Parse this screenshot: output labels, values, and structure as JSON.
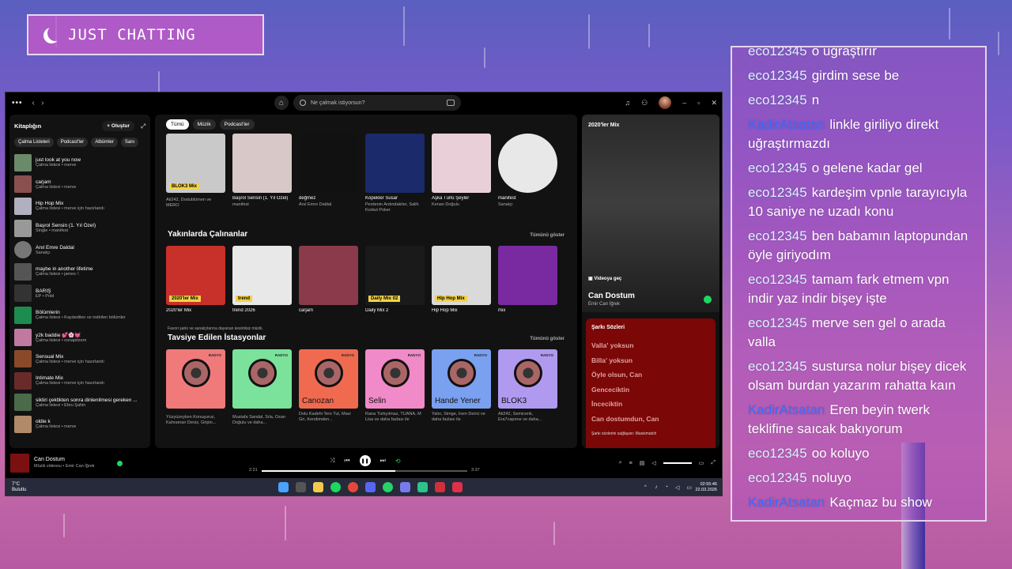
{
  "overlay": {
    "title": "JUST CHATTING"
  },
  "chat": {
    "messages": [
      {
        "user": "eco12345",
        "text": "o uğraştırır",
        "color": "#d9f3ff"
      },
      {
        "user": "eco12345",
        "text": "girdim sese be",
        "color": "#d9f3ff"
      },
      {
        "user": "eco12345",
        "text": "n",
        "color": "#d9f3ff"
      },
      {
        "user": "KadirAtsatan",
        "text": "linkle giriliyo direkt uğraştırmazdı",
        "color": "#3b6dff"
      },
      {
        "user": "eco12345",
        "text": "o gelene kadar gel",
        "color": "#d9f3ff"
      },
      {
        "user": "eco12345",
        "text": "kardeşim vpnle tarayıcıyla 10 saniye ne uzadı konu",
        "color": "#d9f3ff"
      },
      {
        "user": "eco12345",
        "text": "ben babamın laptopundan öyle giriyodım",
        "color": "#d9f3ff"
      },
      {
        "user": "eco12345",
        "text": "tamam fark etmem vpn indir yaz indir bişey işte",
        "color": "#d9f3ff"
      },
      {
        "user": "eco12345",
        "text": "merve sen gel o arada valla",
        "color": "#d9f3ff"
      },
      {
        "user": "eco12345",
        "text": "sustursa nolur bişey dicek olsam burdan yazarım rahatta kaın",
        "color": "#d9f3ff"
      },
      {
        "user": "KadirAtsatan",
        "text": "Eren beyin twerk teklifine saıcak bakıyorum",
        "color": "#3b6dff"
      },
      {
        "user": "eco12345",
        "text": "oo koluyo",
        "color": "#d9f3ff"
      },
      {
        "user": "eco12345",
        "text": "noluyo",
        "color": "#d9f3ff"
      },
      {
        "user": "KadirAtsatan",
        "text": "Kaçmaz bu show",
        "color": "#3b6dff"
      }
    ]
  },
  "spotify": {
    "search_placeholder": "Ne çalmak istiyorsun?",
    "library": {
      "title": "Kitaplığın",
      "create": "+ Oluştur",
      "chips": [
        "Çalma Listeleri",
        "Podcast'ler",
        "Albümler",
        "Sanı"
      ],
      "items": [
        {
          "name": "just look at you now",
          "sub": "Çalma listesi • merve",
          "color": "#6a8a6a",
          "round": false
        },
        {
          "name": "carjam",
          "sub": "Çalma listesi • merve",
          "color": "#8a5050",
          "round": false
        },
        {
          "name": "Hip Hop Mix",
          "sub": "Çalma listesi • merve için hazırlandı",
          "color": "#b0b0c0",
          "round": false
        },
        {
          "name": "Başrol Sensin (1. Yıl Özel)",
          "sub": "Single • manifest",
          "color": "#999",
          "round": false
        },
        {
          "name": "Anıl Emre Daldal",
          "sub": "Sanatçı",
          "color": "#777",
          "round": true
        },
        {
          "name": "maybe in another lifetime",
          "sub": "Çalma listesi • james ☾",
          "color": "#555",
          "round": false
        },
        {
          "name": "BARIŞ",
          "sub": "EP • Pobl",
          "color": "#333",
          "round": false
        },
        {
          "name": "Bölümlerin",
          "sub": "Çalma listesi • Kaydedilen ve indirilen bölümler",
          "color": "#1e8c4e",
          "round": false
        },
        {
          "name": "y2k baddie 💕🌸💓",
          "sub": "Çalma listesi • osnapitzem",
          "color": "#c07aa0",
          "round": false
        },
        {
          "name": "Sensual Mix",
          "sub": "Çalma listesi • merve için hazırlandı",
          "color": "#8a4a2a",
          "round": false
        },
        {
          "name": "Intimate Mix",
          "sub": "Çalma listesi • merve için hazırlandı",
          "color": "#6a2a2a",
          "round": false
        },
        {
          "name": "siktiri çektikten sonra dinlenilmesi gereken ...",
          "sub": "Çalma listesi • Ebru Şahin",
          "color": "#4a6a4a",
          "round": false
        },
        {
          "name": "oldie k",
          "sub": "Çalma listesi • merve",
          "color": "#b08a6a",
          "round": false
        }
      ]
    },
    "tabs": [
      "Tümü",
      "Müzik",
      "Podcast'ler"
    ],
    "top_row": [
      {
        "title": "BLOK3 Mix",
        "sub": "Ati242, Dodublümen ve MERO",
        "color": "#c9c9c9",
        "round": false
      },
      {
        "title": "Başrol Sensin (1. Yıl Özel)",
        "sub": "manifest",
        "color": "#d8c8c8",
        "round": false
      },
      {
        "title": "değmez",
        "sub": "Anıl Emre Daldal",
        "color": "#111",
        "round": false
      },
      {
        "title": "Köpekler Susar",
        "sub": "Perdenin Ardındakiler, Salih Korkut Poker",
        "color": "#1a2a6a",
        "round": false
      },
      {
        "title": "Aşka Türlü Şeyler",
        "sub": "Kenan Doğulu",
        "color": "#e9d0d8",
        "round": false
      },
      {
        "title": "manifest",
        "sub": "Sanatçı",
        "color": "#e8e8e8",
        "round": true
      }
    ],
    "recent": {
      "heading": "Yakınlarda Çalınanlar",
      "show_all": "Tümünü göster",
      "items": [
        {
          "title": "2020'ler Mix",
          "label": "2020'ler Mix",
          "color": "#c8302a"
        },
        {
          "title": "trend 2026",
          "label": "trend",
          "color": "#e8e8e8"
        },
        {
          "title": "carjam",
          "label": "",
          "color": "#8a3a4a"
        },
        {
          "title": "Daily Mix 2",
          "label": "Daily Mix  02",
          "color": "#1a1a1a"
        },
        {
          "title": "Hip Hop Mix",
          "label": "Hip Hop Mix",
          "color": "#dadada"
        },
        {
          "title": "mix",
          "label": "",
          "color": "#7a2aa0"
        }
      ]
    },
    "stations": {
      "small_note": "Favori şarkı ve sanatçılarına dayanan kesintisiz müzik.",
      "heading": "Tavsiye Edilen İstasyonlar",
      "show_all": "Tümünü göster",
      "radio_label": "RADYO",
      "items": [
        {
          "name": "",
          "sub": "Yüzyüzeyken Konuşuruz, Kahraman Deniz, Gripin...",
          "caption": "Gökhan Türkmen",
          "color": "#f07a7a"
        },
        {
          "name": "",
          "sub": "Mustafa Sandal, Sıla, Ozan Doğulu ve daha...",
          "caption": "Kenan Doğulu",
          "color": "#7ae29a"
        },
        {
          "name": "Canozan",
          "sub": "Dolu Kadehi Ters Tut, Mavi Gri, Kendimden...",
          "caption": "",
          "color": "#f06a50"
        },
        {
          "name": "Selin",
          "sub": "Rana Türkyılmaz, TUANA, M Lisa ve daha fazlası ile",
          "caption": "",
          "color": "#f08ac8"
        },
        {
          "name": "Hande Yener",
          "sub": "Yalın, Simge, İrem Derici ve daha fazlası ile",
          "caption": "",
          "color": "#7aa0f0"
        },
        {
          "name": "BLOK3",
          "sub": "Ati242, Semicenk, Era7capone ve daha...",
          "caption": "",
          "color": "#b09af0"
        }
      ]
    },
    "now_playing": {
      "playlist": "2020'ler Mix",
      "video_button": "Videoya geç",
      "title": "Can Dostum",
      "artist": "Emir Can İğrek",
      "lyrics_header": "Şarkı Sözleri",
      "lyrics": [
        "Valla' yoksun",
        "Billa' yoksun",
        "Öyle olsun, Can",
        "Genceciktin",
        "İnceciktin",
        "Can dostumdun, Can"
      ],
      "lyrics_footer": "Şarkı sözlerini sağlayan: Musixmatch"
    },
    "player": {
      "title": "Can Dostum",
      "sub": "Müzik videosu • Emir Can İğrek",
      "elapsed": "2:21",
      "total": "3:37",
      "progress": 0.65
    },
    "taskbar": {
      "temp": "7°C",
      "weather": "Bulutlu",
      "time": "02:55:46",
      "date": "22.03.2026"
    }
  }
}
